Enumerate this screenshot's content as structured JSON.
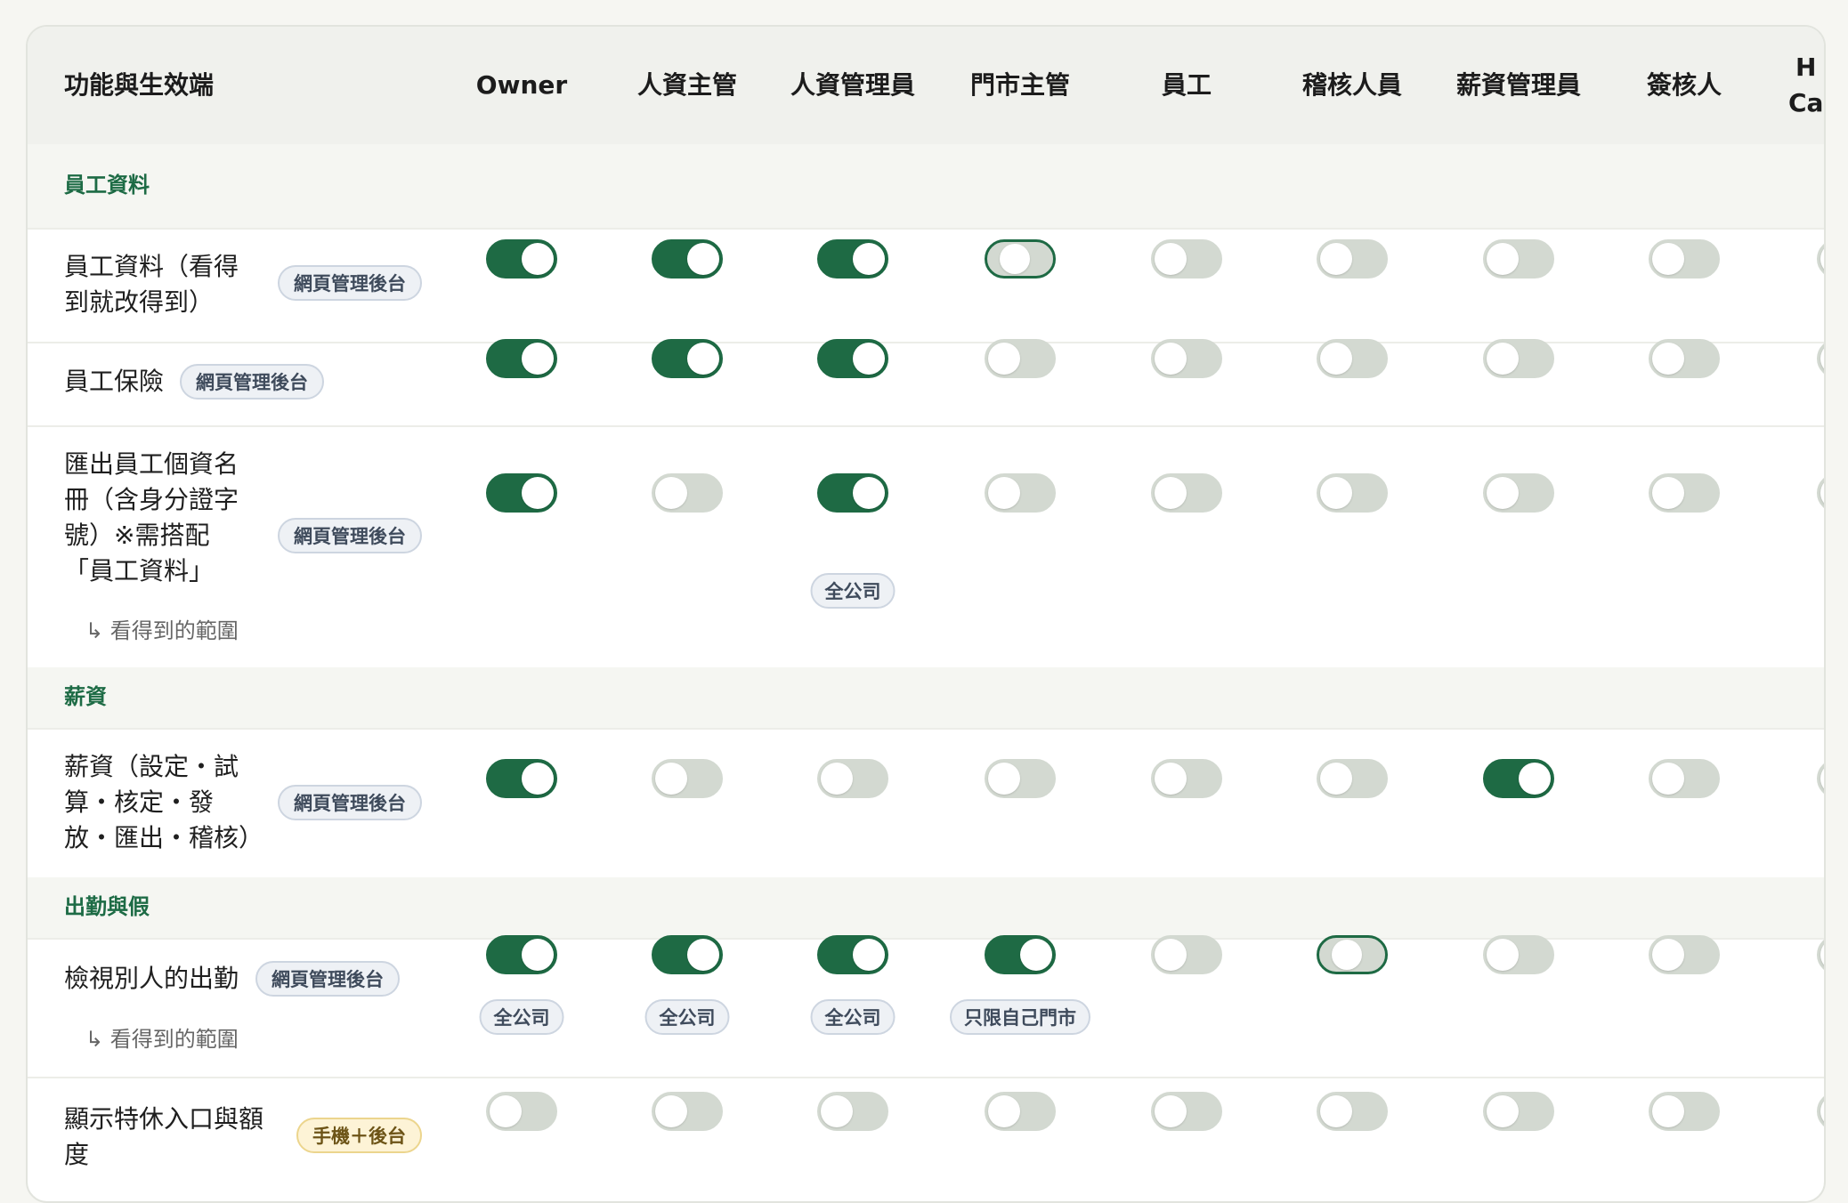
{
  "header": {
    "title": "功能與生效端",
    "columns": [
      "Owner",
      "人資主管",
      "人資管理員",
      "門市主管",
      "員工",
      "稽核人員",
      "薪資管理員",
      "簽核人",
      "H\nCa"
    ]
  },
  "sections": [
    {
      "title": "員工資料",
      "rows": [
        {
          "label": "員工資料（看得\n到就改得到）",
          "badge": "網頁管理後台",
          "badge_kind": "web",
          "toggles": [
            "on",
            "on",
            "on",
            "partial",
            "off",
            "off",
            "off",
            "off",
            "off"
          ]
        },
        {
          "label": "員工保險",
          "badge": "網頁管理後台",
          "badge_kind": "web",
          "toggles": [
            "on",
            "on",
            "on",
            "off",
            "off",
            "off",
            "off",
            "off",
            "off"
          ]
        },
        {
          "label": "匯出員工個資名\n冊（含身分證字\n號）※需搭配\n「員工資料」",
          "badge": "網頁管理後台",
          "badge_kind": "web",
          "toggles": [
            "on",
            "off",
            "on",
            "off",
            "off",
            "off",
            "off",
            "off",
            "off"
          ],
          "scope": {
            "label": "↳ 看得到的範圍",
            "values": [
              "",
              "",
              "全公司",
              "",
              "",
              "",
              "",
              "",
              ""
            ]
          }
        }
      ]
    },
    {
      "title": "薪資",
      "rows": [
        {
          "label": "薪資（設定・試\n算・核定・發\n放・匯出・稽核）",
          "badge": "網頁管理後台",
          "badge_kind": "web",
          "toggles": [
            "on",
            "off",
            "off",
            "off",
            "off",
            "off",
            "on",
            "off",
            "off"
          ]
        }
      ]
    },
    {
      "title": "出勤與假",
      "rows": [
        {
          "label": "檢視別人的出勤",
          "badge": "網頁管理後台",
          "badge_kind": "web",
          "toggles": [
            "on",
            "on",
            "on",
            "on",
            "off",
            "partial",
            "off",
            "off",
            "off"
          ],
          "scope": {
            "label": "↳ 看得到的範圍",
            "values": [
              "全公司",
              "全公司",
              "全公司",
              "只限自己門市",
              "",
              "",
              "",
              "",
              ""
            ]
          }
        },
        {
          "label": "顯示特休入口與額\n度",
          "badge": "手機＋後台",
          "badge_kind": "mobile",
          "toggles": [
            "off",
            "off",
            "off",
            "off",
            "off",
            "off",
            "off",
            "off",
            "off"
          ]
        }
      ]
    }
  ],
  "colors": {
    "accent": "#1e6a44",
    "toggle_off": "#d3d9d1",
    "section_title": "#1d6b45"
  }
}
